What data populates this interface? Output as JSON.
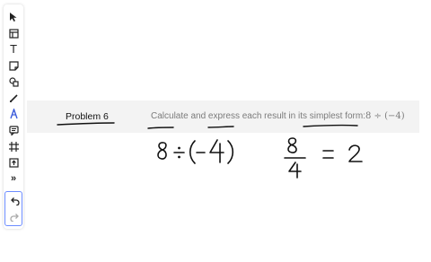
{
  "toolbar": {
    "tools": [
      {
        "name": "select",
        "icon": "pointer-icon"
      },
      {
        "name": "table",
        "icon": "table-icon"
      },
      {
        "name": "text",
        "icon": "text-icon",
        "glyph": "T"
      },
      {
        "name": "sticky-note",
        "icon": "sticky-note-icon"
      },
      {
        "name": "shapes",
        "icon": "shapes-icon"
      },
      {
        "name": "pen",
        "icon": "pen-icon"
      },
      {
        "name": "highlighter",
        "icon": "highlighter-icon",
        "active": true
      },
      {
        "name": "comment",
        "icon": "comment-icon"
      },
      {
        "name": "frame",
        "icon": "frame-icon"
      },
      {
        "name": "upload",
        "icon": "upload-icon"
      },
      {
        "name": "more",
        "icon": "more-icon",
        "glyph": "»"
      }
    ],
    "undo_icon": "undo-icon",
    "redo_icon": "redo-icon",
    "accent_color": "#3b5bdb"
  },
  "problem": {
    "title": "Problem 6",
    "instruction": "Calculate and express each result in its simplest form:",
    "expression": "8 ÷ (−4)"
  },
  "handwriting": {
    "expression": "8÷(-4)",
    "numerator": "8",
    "denominator": "4",
    "equals": "=",
    "result": "2",
    "ink_color": "#111111"
  }
}
